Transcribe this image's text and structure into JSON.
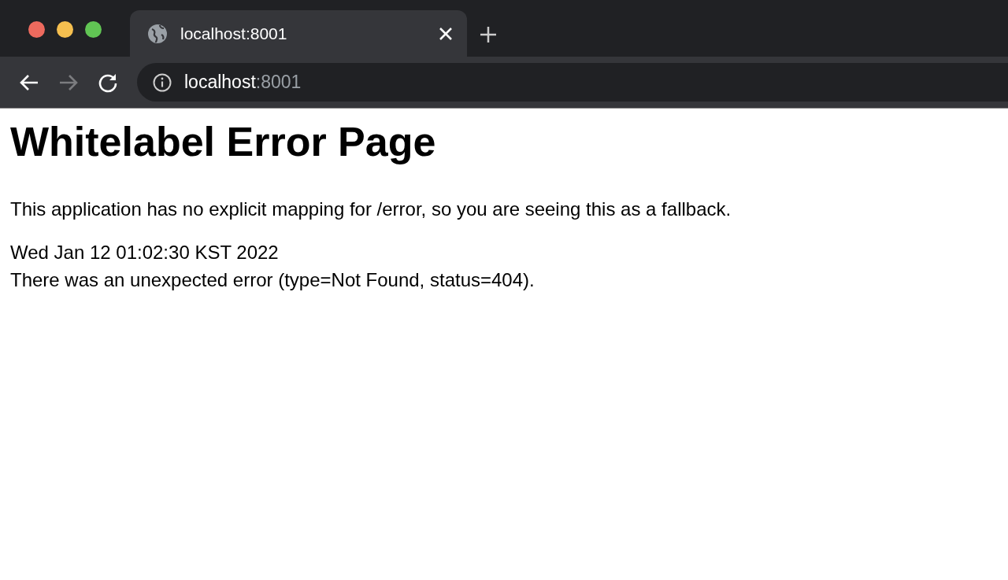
{
  "browser": {
    "tabs": [
      {
        "title": "localhost:8001",
        "selected": true
      }
    ],
    "back_disabled": false,
    "forward_disabled": true,
    "address": {
      "host": "localhost",
      "port": ":8001"
    }
  },
  "page": {
    "heading": "Whitelabel Error Page",
    "message": "This application has no explicit mapping for /error, so you are seeing this as a fallback.",
    "details": [
      "Wed Jan 12 01:02:30 KST 2022",
      "There was an unexpected error (type=Not Found, status=404)."
    ]
  }
}
